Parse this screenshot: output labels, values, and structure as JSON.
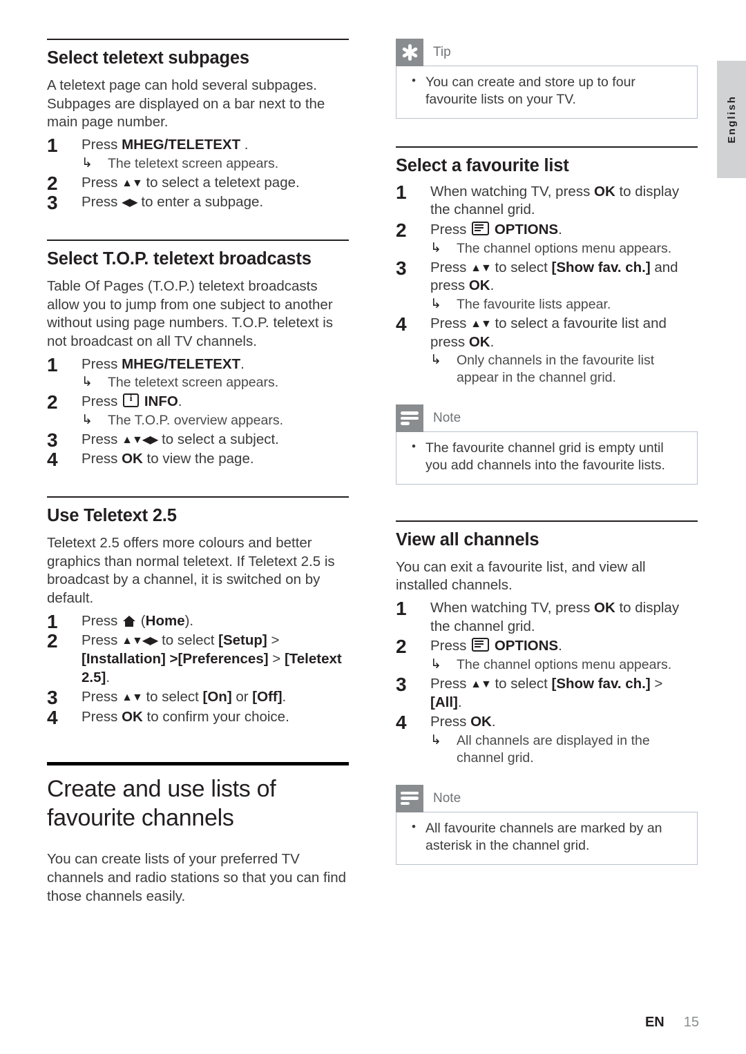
{
  "page": {
    "language_tab": "English",
    "footer_code": "EN",
    "footer_page": "15"
  },
  "icons": {
    "tip": "tip-asterisk-icon",
    "note": "note-lines-icon",
    "info": "info-button-icon",
    "options": "options-button-icon",
    "home": "home-button-icon",
    "arrow_result": "↳",
    "arrows_updown": "▲▼",
    "arrows_leftright": "◀▶",
    "arrows_all": "▲▼◀▶"
  },
  "left_column": {
    "sections": [
      {
        "title": "Select teletext subpages",
        "intro": "A teletext page can hold several subpages. Subpages are displayed on a bar next to the main page number.",
        "steps": [
          {
            "pre": "Press ",
            "bold": "MHEG/TELETEXT",
            "post": " .",
            "result": "The teletext screen appears."
          },
          {
            "pre": "Press ",
            "arrows": "▲▼",
            "post": " to select a teletext page."
          },
          {
            "pre": "Press ",
            "arrows": "◀▶",
            "post": " to enter a subpage."
          }
        ]
      },
      {
        "title": "Select T.O.P. teletext broadcasts",
        "intro": "Table Of Pages (T.O.P.) teletext broadcasts allow you to jump from one subject to another without using page numbers. T.O.P. teletext is not broadcast on all TV channels.",
        "steps": [
          {
            "pre": "Press ",
            "bold": "MHEG/TELETEXT",
            "post": ".",
            "result": "The teletext screen appears."
          },
          {
            "pre": "Press ",
            "icon": "info",
            "bold": "INFO",
            "post": ".",
            "result": "The T.O.P. overview appears."
          },
          {
            "pre": "Press ",
            "arrows": "▲▼◀▶",
            "post": " to select a subject."
          },
          {
            "pre": "Press ",
            "bold": "OK",
            "post": " to view the page."
          }
        ]
      },
      {
        "title": "Use Teletext 2.5",
        "intro": "Teletext 2.5 offers more colours and better graphics than normal teletext. If Teletext 2.5 is broadcast by a channel, it is switched on by default.",
        "steps": [
          {
            "pre": "Press ",
            "icon": "home",
            "post": " (",
            "bold": "Home",
            "post2": ")."
          },
          {
            "pre": "Press ",
            "arrows": "▲▼◀▶",
            "post": " to select ",
            "bold": "[Setup]",
            "post2": " > ",
            "bold2": "[Installation] >[Preferences]",
            "post3": " > ",
            "bold3": "[Teletext 2.5]",
            "post4": "."
          },
          {
            "pre": "Press ",
            "arrows": "▲▼",
            "post": " to select ",
            "bold": "[On]",
            "post2": " or ",
            "bold2": "[Off]",
            "post3": "."
          },
          {
            "pre": "Press ",
            "bold": "OK",
            "post": " to confirm your choice."
          }
        ]
      }
    ],
    "chapter": {
      "title": "Create and use lists of favourite channels",
      "intro": "You can create lists of your preferred TV channels and radio stations so that you can find those channels easily."
    }
  },
  "right_column": {
    "tip_box": {
      "label": "Tip",
      "items": [
        "You can create and store up to four favourite lists on your TV."
      ]
    },
    "section_favourite": {
      "title": "Select a favourite list",
      "steps": [
        {
          "pre": "When watching TV, press ",
          "bold": "OK",
          "post": " to display the channel grid."
        },
        {
          "pre": "Press ",
          "icon": "options",
          "bold": "OPTIONS",
          "post": ".",
          "result": "The channel options menu appears."
        },
        {
          "pre": "Press ",
          "arrows": "▲▼",
          "post": " to select ",
          "bold": "[Show fav. ch.]",
          "post2": " and press ",
          "bold2": "OK",
          "post3": ".",
          "result": "The favourite lists appear."
        },
        {
          "pre": "Press ",
          "arrows": "▲▼",
          "post": " to select a favourite list and press ",
          "bold": "OK",
          "post2": ".",
          "result": "Only channels in the favourite list appear in the channel grid."
        }
      ]
    },
    "note_box_1": {
      "label": "Note",
      "items": [
        "The favourite channel grid is empty until you add channels into the favourite lists."
      ]
    },
    "section_view_all": {
      "title": "View all channels",
      "intro": "You can exit a favourite list, and view all installed channels.",
      "steps": [
        {
          "pre": "When watching TV, press ",
          "bold": "OK",
          "post": " to display the channel grid."
        },
        {
          "pre": "Press ",
          "icon": "options",
          "bold": "OPTIONS",
          "post": ".",
          "result": "The channel options menu appears."
        },
        {
          "pre": "Press ",
          "arrows": "▲▼",
          "post": " to select ",
          "bold": "[Show fav. ch.]",
          "post2": " > ",
          "bold2": "[All]",
          "post3": "."
        },
        {
          "pre": "Press ",
          "bold": "OK",
          "post": ".",
          "result": "All channels are displayed in the channel grid."
        }
      ]
    },
    "note_box_2": {
      "label": "Note",
      "items": [
        "All favourite channels are marked by an asterisk in the channel grid."
      ]
    }
  }
}
